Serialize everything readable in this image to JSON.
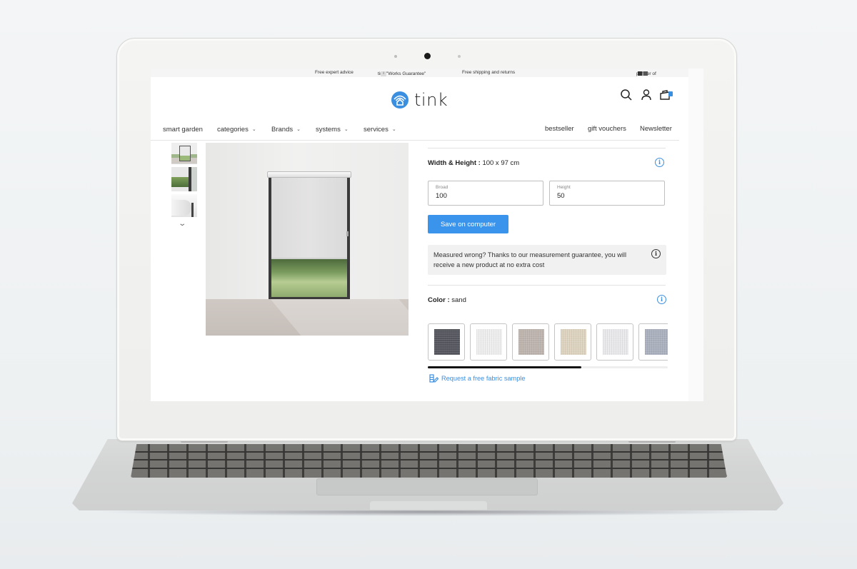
{
  "topbar": {
    "items": [
      "Free expert advice",
      "tink \"Works Guarantee\"",
      "Free shipping and returns"
    ],
    "info_glyph": "i",
    "partner_label": "partner of"
  },
  "header": {
    "brand": "tink",
    "icons": [
      "search-icon",
      "user-icon",
      "cart-icon"
    ],
    "accent_color": "#3a8fe0"
  },
  "nav": {
    "left": [
      {
        "label": "smart garden",
        "dropdown": false
      },
      {
        "label": "categories",
        "dropdown": true
      },
      {
        "label": "Brands",
        "dropdown": true
      },
      {
        "label": "systems",
        "dropdown": true
      },
      {
        "label": "services",
        "dropdown": true
      }
    ],
    "right": [
      "bestseller",
      "gift vouchers",
      "Newsletter"
    ],
    "chevron": "⌄"
  },
  "gallery": {
    "thumbnails": [
      "roller-blind-room-view",
      "roller-blind-side-detail",
      "roller-blind-cassette-detail"
    ],
    "more_chevron": "⌄"
  },
  "config": {
    "size": {
      "label": "Width & Height :",
      "value": "100 x 97 cm",
      "broad_label": "Broad",
      "broad_value": "100",
      "height_label": "Height",
      "height_value": "50"
    },
    "save_button": "Save on computer",
    "notice": "Measured wrong? Thanks to our measurement guarantee, you will receive a new product at no extra cost",
    "color": {
      "label": "Color :",
      "value": "sand",
      "swatches": [
        {
          "name": "anthracite",
          "hex": "#55575e"
        },
        {
          "name": "white",
          "hex": "#eeeeee"
        },
        {
          "name": "taupe",
          "hex": "#bdb4ae"
        },
        {
          "name": "sand",
          "hex": "#ddd3bf"
        },
        {
          "name": "light-grey",
          "hex": "#e9e9ec"
        },
        {
          "name": "blue-grey",
          "hex": "#aab0bd"
        }
      ],
      "scroll_progress": 0.64
    },
    "sample_link": "Request a free fabric sample"
  }
}
